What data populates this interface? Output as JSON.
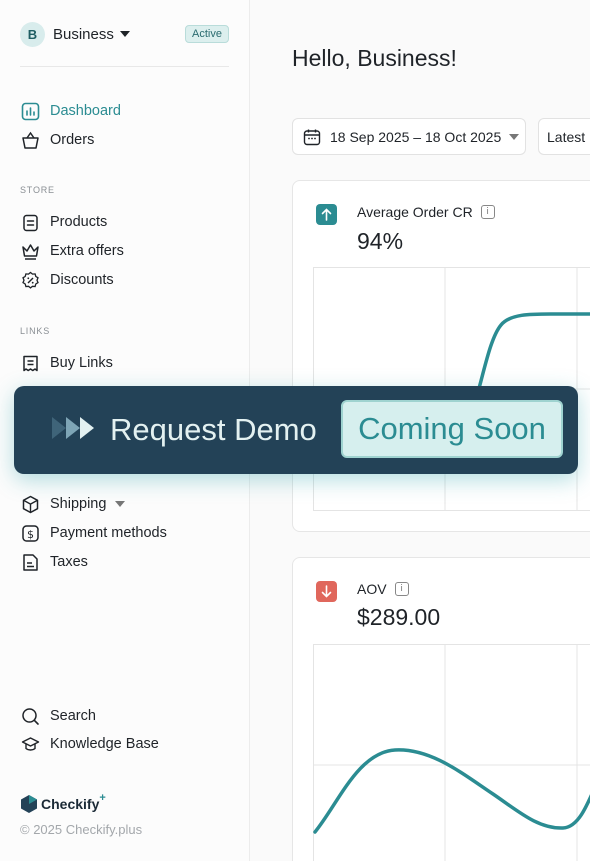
{
  "account": {
    "initial": "B",
    "name": "Business",
    "status_badge": "Active"
  },
  "nav": {
    "dashboard": "Dashboard",
    "orders": "Orders",
    "store_label": "STORE",
    "products": "Products",
    "extra_offers": "Extra offers",
    "discounts": "Discounts",
    "links_label": "LINKS",
    "buy_links": "Buy Links",
    "shipping": "Shipping",
    "payment_methods": "Payment methods",
    "taxes": "Taxes",
    "search": "Search",
    "knowledge_base": "Knowledge Base"
  },
  "brand": {
    "name": "Checkify",
    "plus": "+",
    "copyright": "© 2025 Checkify.plus"
  },
  "main": {
    "greeting": "Hello, Business!",
    "date_range": "18 Sep 2025 – 18 Oct 2025",
    "latest_select": "Latest"
  },
  "cards": [
    {
      "title": "Average Order CR",
      "value": "94%",
      "trend": "up",
      "color": "#2b8c92"
    },
    {
      "title": "AOV",
      "value": "$289.00",
      "trend": "down",
      "color": "#e0675c"
    }
  ],
  "banner": {
    "text": "Request Demo",
    "pill": "Coming Soon"
  },
  "colors": {
    "accent": "#2b8c92",
    "banner_bg": "#234257",
    "down": "#e0675c"
  }
}
